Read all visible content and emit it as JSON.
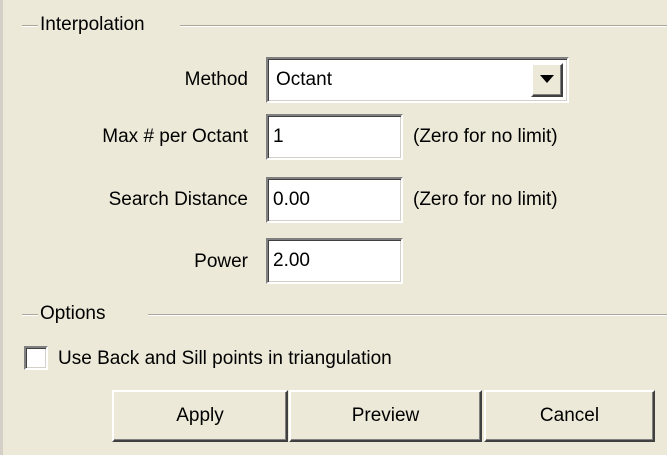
{
  "interpolation": {
    "group_title": "Interpolation",
    "method": {
      "label": "Method",
      "value": "Octant",
      "arrow_icon": "chevron-down-icon"
    },
    "max_per_octant": {
      "label": "Max # per Octant",
      "value": "1",
      "hint": "(Zero for no limit)"
    },
    "search_distance": {
      "label": "Search Distance",
      "value": "0.00",
      "hint": "(Zero for no limit)"
    },
    "power": {
      "label": "Power",
      "value": "2.00"
    }
  },
  "options": {
    "group_title": "Options",
    "use_back_sill": {
      "label": "Use Back and Sill points in triangulation",
      "checked": false
    }
  },
  "buttons": {
    "apply": "Apply",
    "preview": "Preview",
    "cancel": "Cancel"
  }
}
